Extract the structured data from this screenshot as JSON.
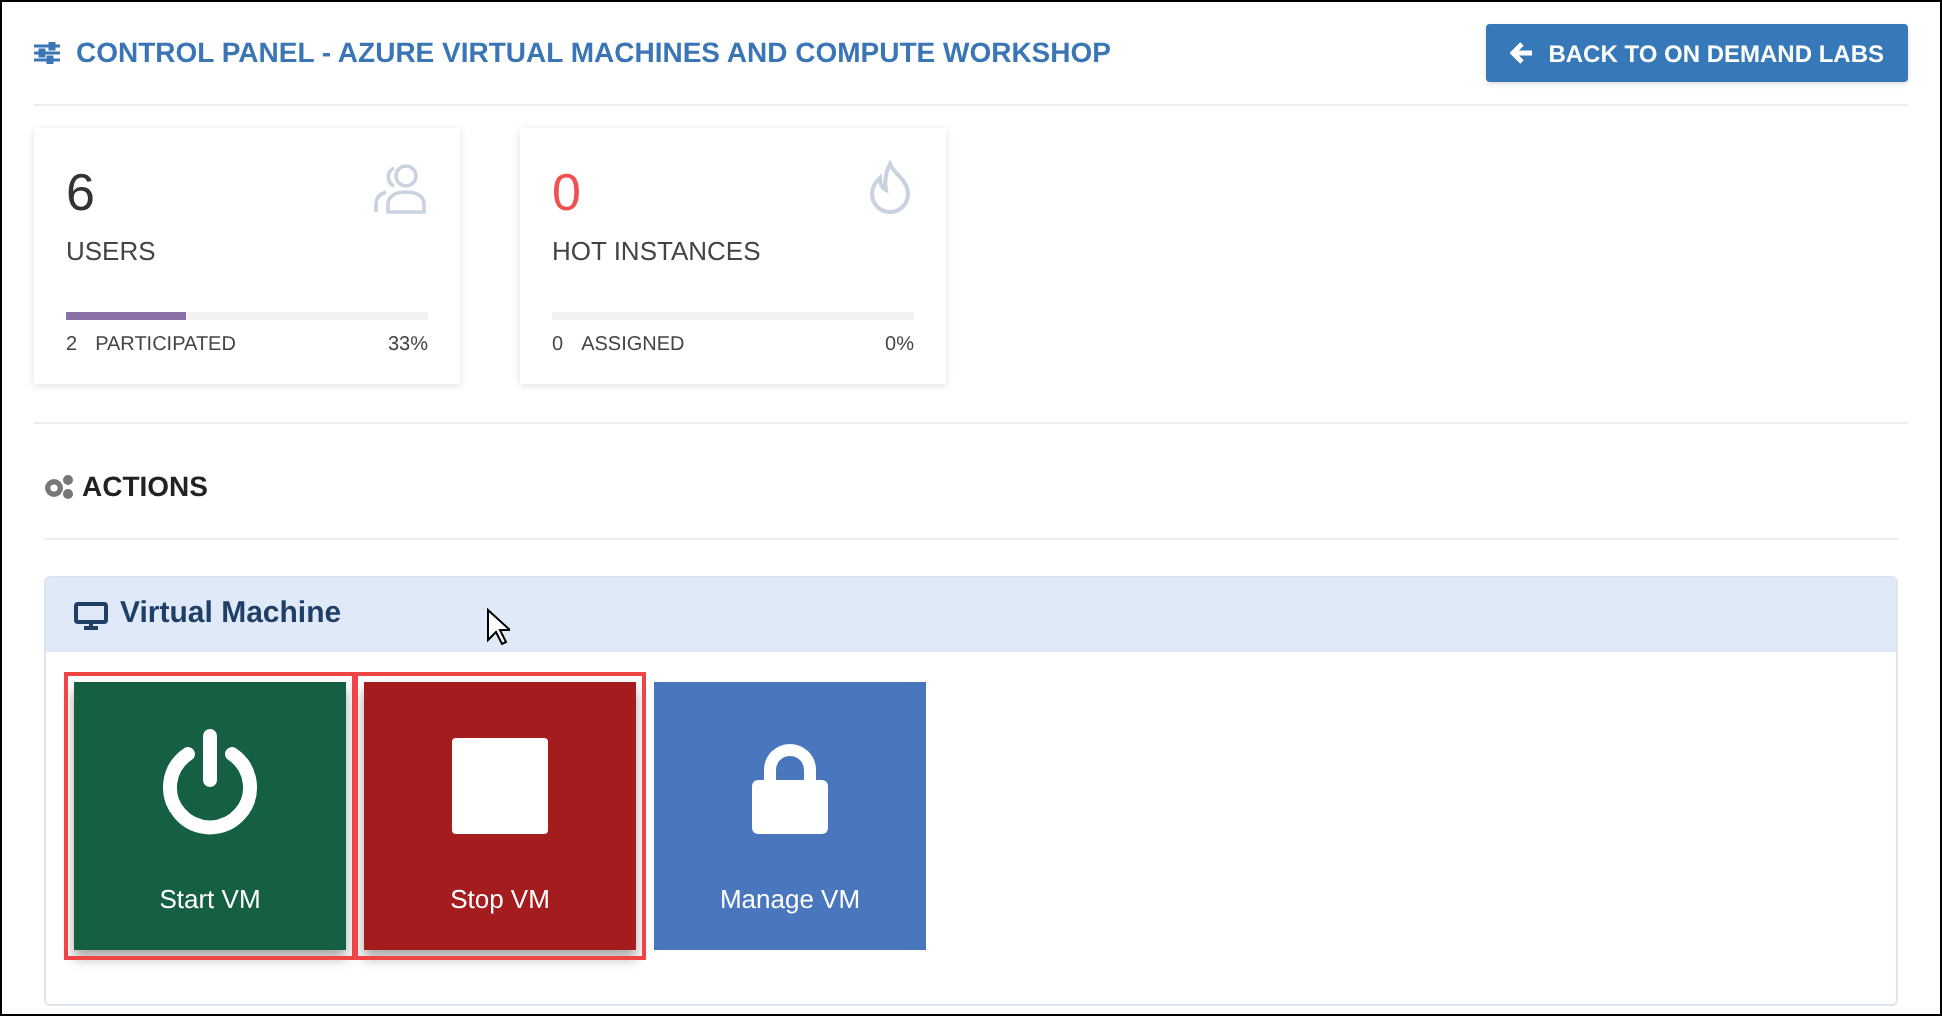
{
  "header": {
    "title": "CONTROL PANEL - AZURE VIRTUAL MACHINES AND COMPUTE WORKSHOP",
    "back_button": "BACK TO ON DEMAND LABS"
  },
  "stats": [
    {
      "kind": "users",
      "value": "6",
      "color": "#333333",
      "label": "USERS",
      "count": "2",
      "sub_label": "PARTICIPATED",
      "percent": "33%",
      "level": 0.33
    },
    {
      "kind": "fire",
      "value": "0",
      "color": "#f0504f",
      "label": "HOT INSTANCES",
      "count": "0",
      "sub_label": "ASSIGNED",
      "percent": "0%",
      "level": 0
    }
  ],
  "actions": {
    "title": "ACTIONS",
    "panel": {
      "title": "Virtual Machine",
      "tiles": [
        {
          "kind": "power",
          "label": "Start VM",
          "color": "#156043",
          "highlighted": true
        },
        {
          "kind": "stop",
          "label": "Stop VM",
          "color": "#a51c1f",
          "highlighted": true
        },
        {
          "kind": "lock",
          "label": "Manage VM",
          "color": "#4a76be",
          "highlighted": false
        }
      ]
    }
  }
}
